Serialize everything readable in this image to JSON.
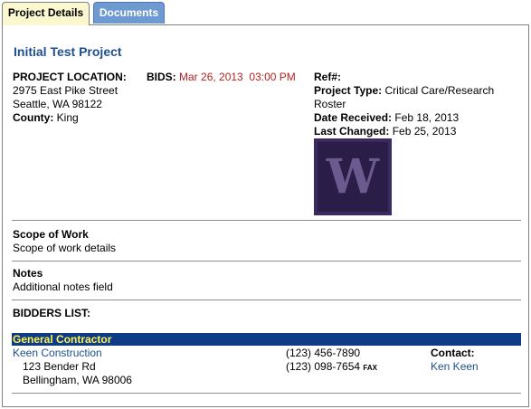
{
  "tabs": {
    "project_details": "Project Details",
    "documents": "Documents"
  },
  "project": {
    "title": "Initial Test Project",
    "location_label": "PROJECT LOCATION:",
    "address_line1": "2975 East Pike Street",
    "address_line2": "Seattle, WA 98122",
    "county_label": "County:",
    "county_value": "King",
    "bids_label": "BIDS:",
    "bids_value": "Mar 26, 2013  03:00 PM",
    "ref_label": "Ref#:",
    "type_label": "Project Type:",
    "type_value": "Critical Care/Research",
    "type_value2": "Roster",
    "received_label": "Date Received:",
    "received_value": "Feb 18, 2013",
    "changed_label": "Last Changed:",
    "changed_value": "Feb 25, 2013",
    "logo_letter": "W"
  },
  "scope": {
    "label": "Scope of Work",
    "value": "Scope of work details"
  },
  "notes": {
    "label": "Notes",
    "value": "Additional notes field"
  },
  "bidders": {
    "label": "BIDDERS LIST:",
    "group": "General Contractor",
    "company": "Keen Construction",
    "street": "123 Bender Rd",
    "city": "Bellingham, WA  98006",
    "phone": "(123) 456-7890",
    "fax_number": "(123) 098-7654",
    "fax_label": "FAX",
    "contact_label": "Contact:",
    "contact_name": "Ken Keen"
  },
  "colors": {
    "accent": "#1f4f8f",
    "band": "#0f3a87",
    "band_text": "#fff34a",
    "bids": "#b22222"
  }
}
